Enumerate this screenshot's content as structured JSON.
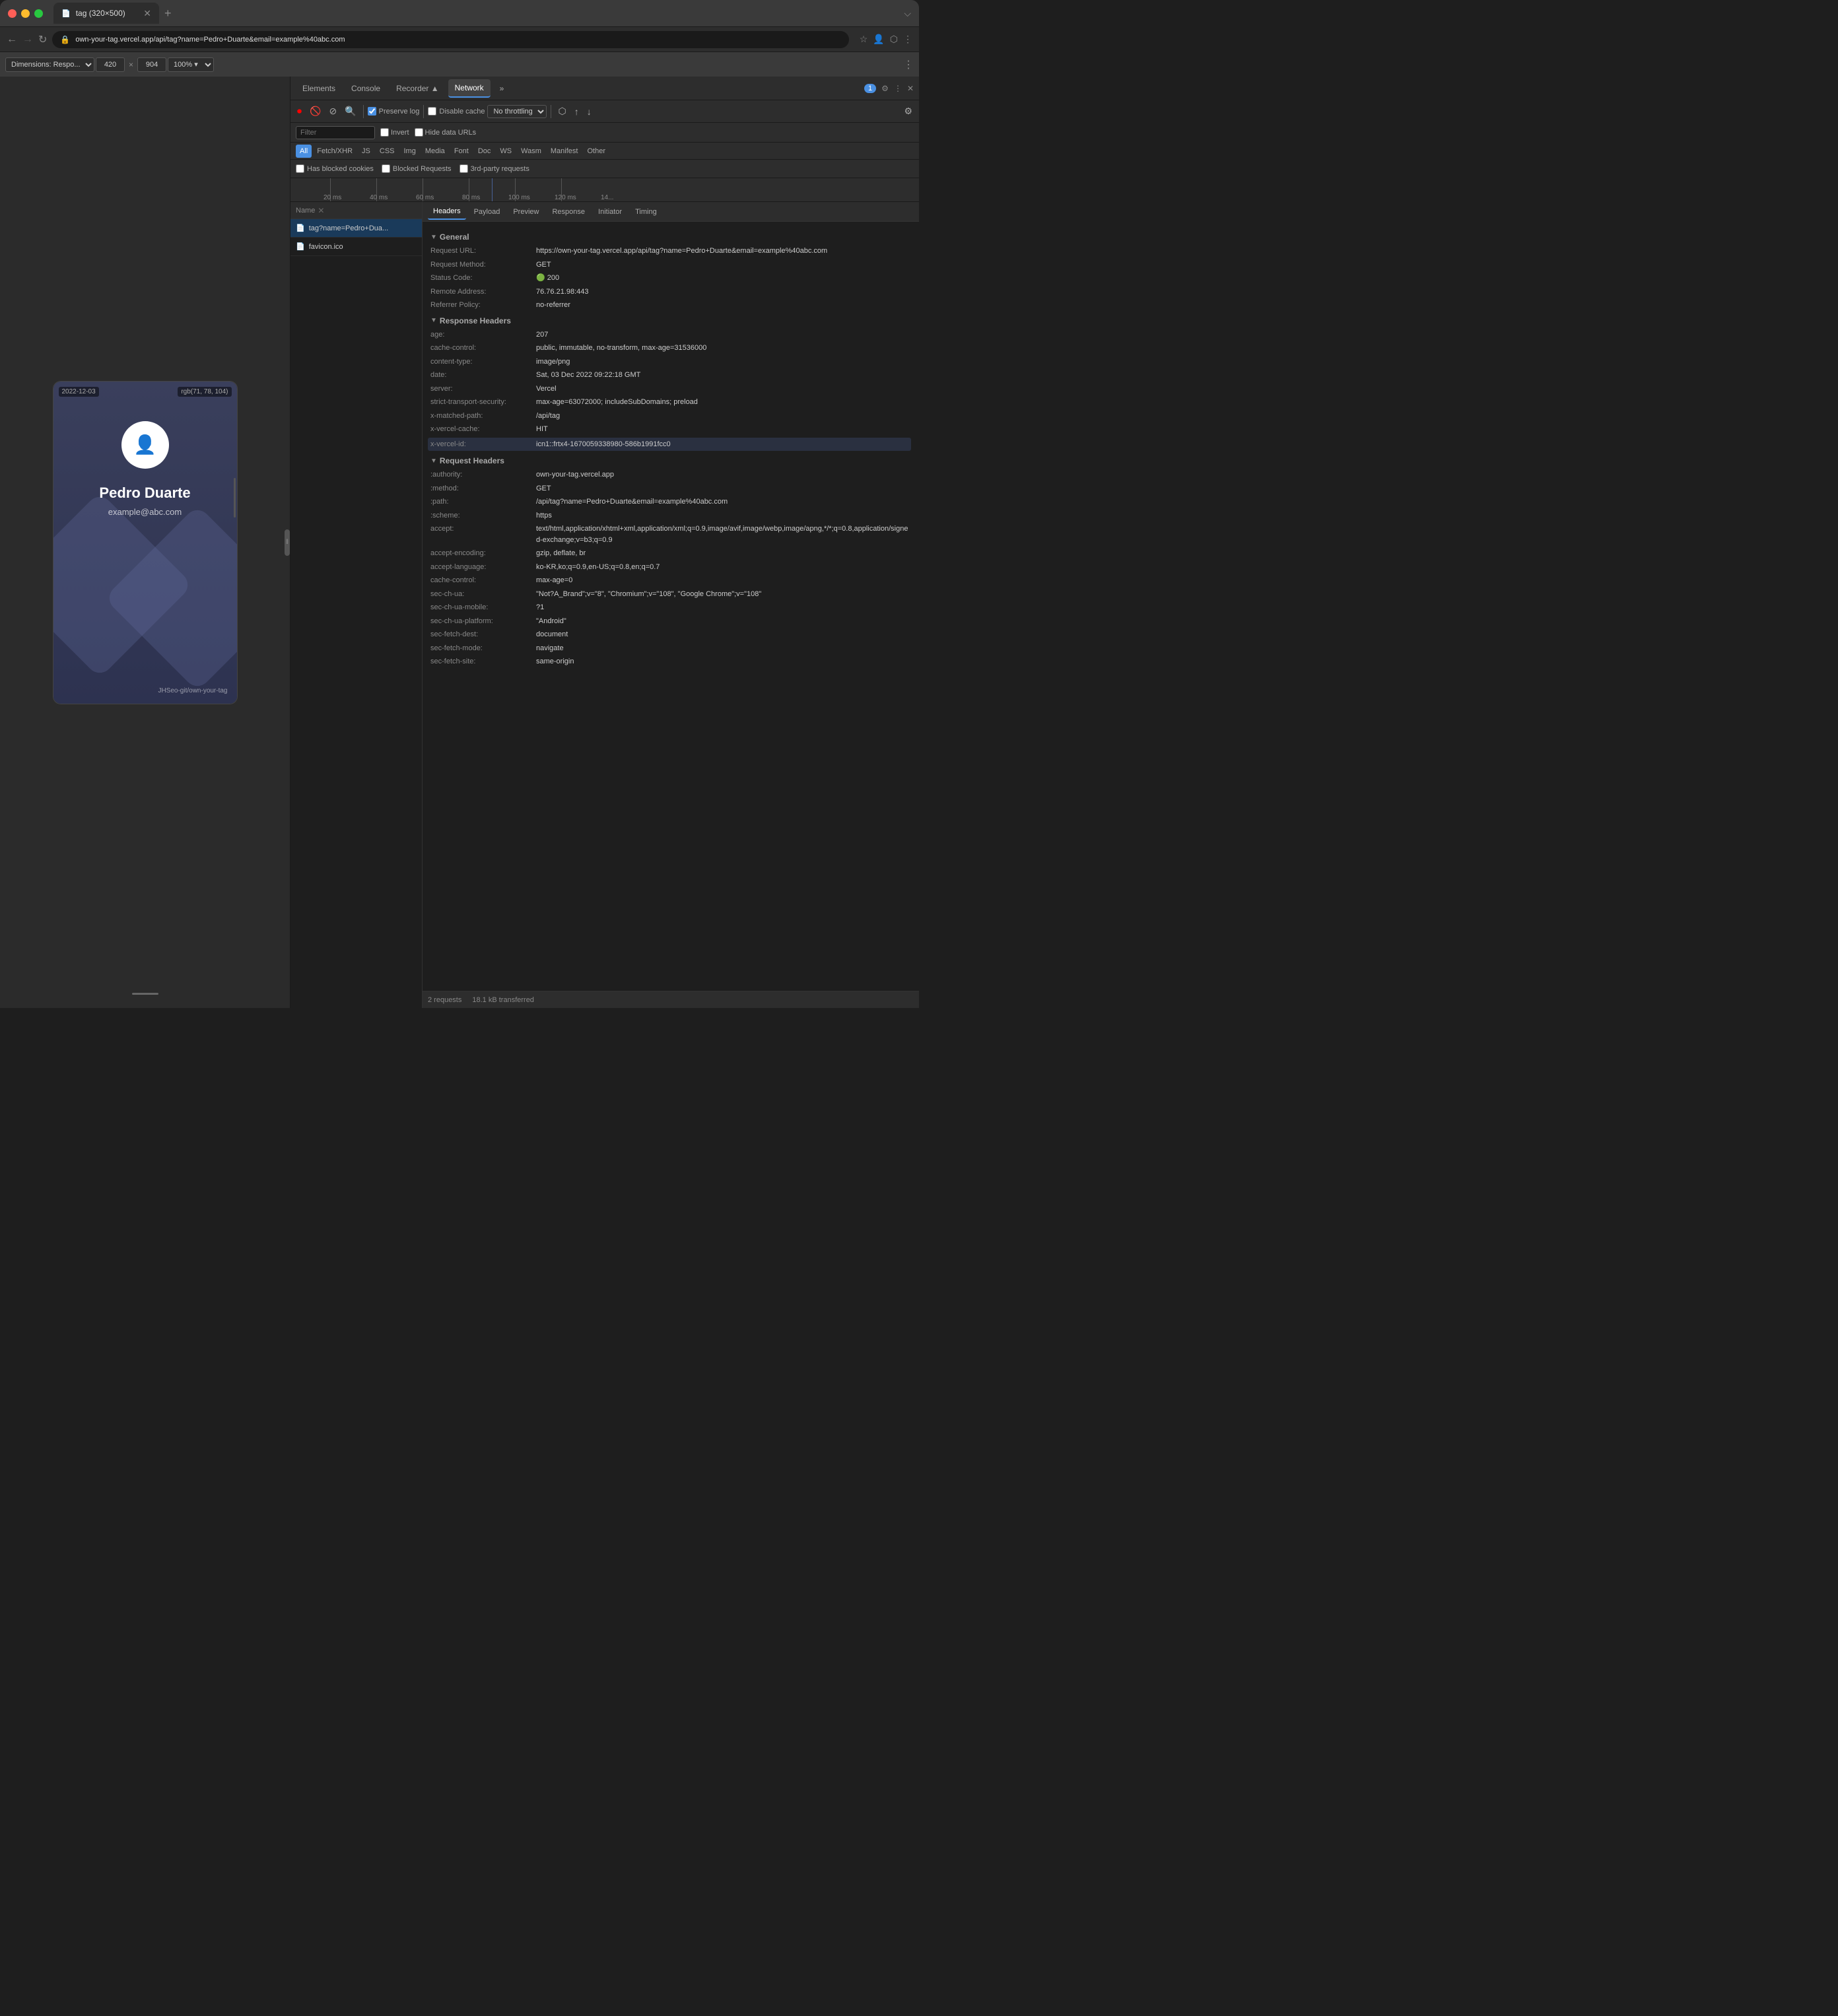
{
  "browser": {
    "tab_title": "tag (320×500)",
    "url": "own-your-tag.vercel.app/api/tag?name=Pedro+Duarte&email=example%40abc.com",
    "close_icon": "✕",
    "new_tab_icon": "+",
    "menu_icon": "⌵"
  },
  "devtools_bar": {
    "dimension_label": "Dimensions: Respo...",
    "width": "420",
    "height": "904",
    "zoom": "100%"
  },
  "device_preview": {
    "date_label": "2022-12-03",
    "color_label": "rgb(71, 78, 104)",
    "card_name": "Pedro Duarte",
    "card_email": "example@abc.com",
    "card_footer": "JHSeo-git/own-your-tag"
  },
  "devtools": {
    "tabs": [
      "Elements",
      "Console",
      "Recorder ▲",
      "Network",
      "»"
    ],
    "active_tab": "Network",
    "icons_right": [
      "⚙",
      "⋮",
      "✕"
    ],
    "network_badge": "1"
  },
  "network_toolbar": {
    "record_icon": "⏺",
    "clear_icon": "🚫",
    "filter_icon": "⊘",
    "search_icon": "🔍",
    "preserve_log_label": "Preserve log",
    "disable_cache_label": "Disable cache",
    "throttle_label": "No throttling",
    "wifi_icon": "⬡",
    "upload_icon": "↑",
    "download_icon": "↓",
    "settings_icon": "⚙"
  },
  "filter_bar": {
    "filter_placeholder": "Filter",
    "invert_label": "Invert",
    "hide_urls_label": "Hide data URLs"
  },
  "type_filters": [
    "All",
    "Fetch/XHR",
    "JS",
    "CSS",
    "Img",
    "Media",
    "Font",
    "Doc",
    "WS",
    "Wasm",
    "Manifest",
    "Other"
  ],
  "blocked_bar": {
    "has_blocked_cookies_label": "Has blocked cookies",
    "blocked_requests_label": "Blocked Requests",
    "third_party_label": "3rd-party requests"
  },
  "timeline": {
    "markers": [
      "20 ms",
      "40 ms",
      "60 ms",
      "80 ms",
      "100 ms",
      "120 ms",
      "14..."
    ]
  },
  "requests": [
    {
      "name": "tag?name=Pedro+Dua...",
      "icon": "📄",
      "active": true
    },
    {
      "name": "favicon.ico",
      "icon": "📄",
      "active": false
    }
  ],
  "headers_tabs": [
    "Headers",
    "Payload",
    "Preview",
    "Response",
    "Initiator",
    "Timing"
  ],
  "headers_active_tab": "Headers",
  "general_section": {
    "title": "General",
    "rows": [
      {
        "key": "Request URL:",
        "val": "https://own-your-tag.vercel.app/api/tag?name=Pedro+Duarte&email=example%40abc.com"
      },
      {
        "key": "Request Method:",
        "val": "GET"
      },
      {
        "key": "Status Code:",
        "val": "🟢 200",
        "status": true
      },
      {
        "key": "Remote Address:",
        "val": "76.76.21.98:443"
      },
      {
        "key": "Referrer Policy:",
        "val": "no-referrer"
      }
    ]
  },
  "response_headers_section": {
    "title": "Response Headers",
    "rows": [
      {
        "key": "age:",
        "val": "207"
      },
      {
        "key": "cache-control:",
        "val": "public, immutable, no-transform, max-age=31536000"
      },
      {
        "key": "content-type:",
        "val": "image/png"
      },
      {
        "key": "date:",
        "val": "Sat, 03 Dec 2022 09:22:18 GMT"
      },
      {
        "key": "server:",
        "val": "Vercel"
      },
      {
        "key": "strict-transport-security:",
        "val": "max-age=63072000; includeSubDomains; preload"
      },
      {
        "key": "x-matched-path:",
        "val": "/api/tag"
      },
      {
        "key": "x-vercel-cache:",
        "val": "HIT"
      },
      {
        "key": "x-vercel-id:",
        "val": "icn1::frtx4-1670059338980-586b1991fcc0",
        "highlighted": true
      }
    ]
  },
  "request_headers_section": {
    "title": "Request Headers",
    "rows": [
      {
        "key": ":authority:",
        "val": "own-your-tag.vercel.app"
      },
      {
        "key": ":method:",
        "val": "GET"
      },
      {
        "key": ":path:",
        "val": "/api/tag?name=Pedro+Duarte&email=example%40abc.com"
      },
      {
        "key": ":scheme:",
        "val": "https"
      },
      {
        "key": "accept:",
        "val": "text/html,application/xhtml+xml,application/xml;q=0.9,image/avif,image/webp,image/apng,*/*;q=0.8,application/signed-exchange;v=b3;q=0.9"
      },
      {
        "key": "accept-encoding:",
        "val": "gzip, deflate, br"
      },
      {
        "key": "accept-language:",
        "val": "ko-KR,ko;q=0.9,en-US;q=0.8,en;q=0.7"
      },
      {
        "key": "cache-control:",
        "val": "max-age=0"
      },
      {
        "key": "sec-ch-ua:",
        "val": "\"Not?A_Brand\";v=\"8\", \"Chromium\";v=\"108\", \"Google Chrome\";v=\"108\""
      },
      {
        "key": "sec-ch-ua-mobile:",
        "val": "?1"
      },
      {
        "key": "sec-ch-ua-platform:",
        "val": "\"Android\""
      },
      {
        "key": "sec-fetch-dest:",
        "val": "document"
      },
      {
        "key": "sec-fetch-mode:",
        "val": "navigate"
      },
      {
        "key": "sec-fetch-site:",
        "val": "same-origin"
      }
    ]
  },
  "status_bar": {
    "requests_count": "2 requests",
    "transfer_size": "18.1 kB transferred"
  }
}
